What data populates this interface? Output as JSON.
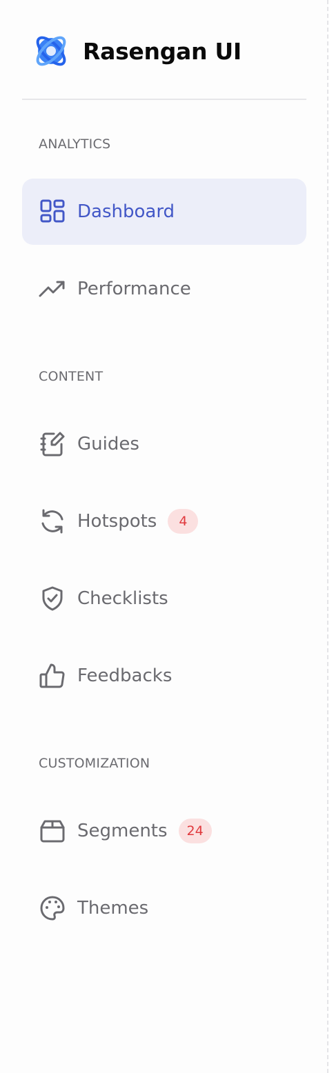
{
  "brand": {
    "name": "Rasengan UI",
    "logo_icon": "rasengan-logo-icon",
    "logo_color": "#3b82f6"
  },
  "colors": {
    "active_bg": "#eceef9",
    "active_text": "#4257c7",
    "text": "#6a6a6f",
    "badge_bg": "#fbe0e0",
    "badge_text": "#e0393d"
  },
  "sections": [
    {
      "title": "ANALYTICS",
      "items": [
        {
          "label": "Dashboard",
          "icon": "dashboard-icon",
          "active": true
        },
        {
          "label": "Performance",
          "icon": "trending-up-icon",
          "active": false
        }
      ]
    },
    {
      "title": "CONTENT",
      "items": [
        {
          "label": "Guides",
          "icon": "notebook-pen-icon",
          "active": false
        },
        {
          "label": "Hotspots",
          "icon": "refresh-icon",
          "active": false,
          "badge": "4"
        },
        {
          "label": "Checklists",
          "icon": "shield-check-icon",
          "active": false
        },
        {
          "label": "Feedbacks",
          "icon": "thumbs-up-icon",
          "active": false
        }
      ]
    },
    {
      "title": "CUSTOMIZATION",
      "items": [
        {
          "label": "Segments",
          "icon": "box-icon",
          "active": false,
          "badge": "24"
        },
        {
          "label": "Themes",
          "icon": "palette-icon",
          "active": false
        }
      ]
    }
  ]
}
